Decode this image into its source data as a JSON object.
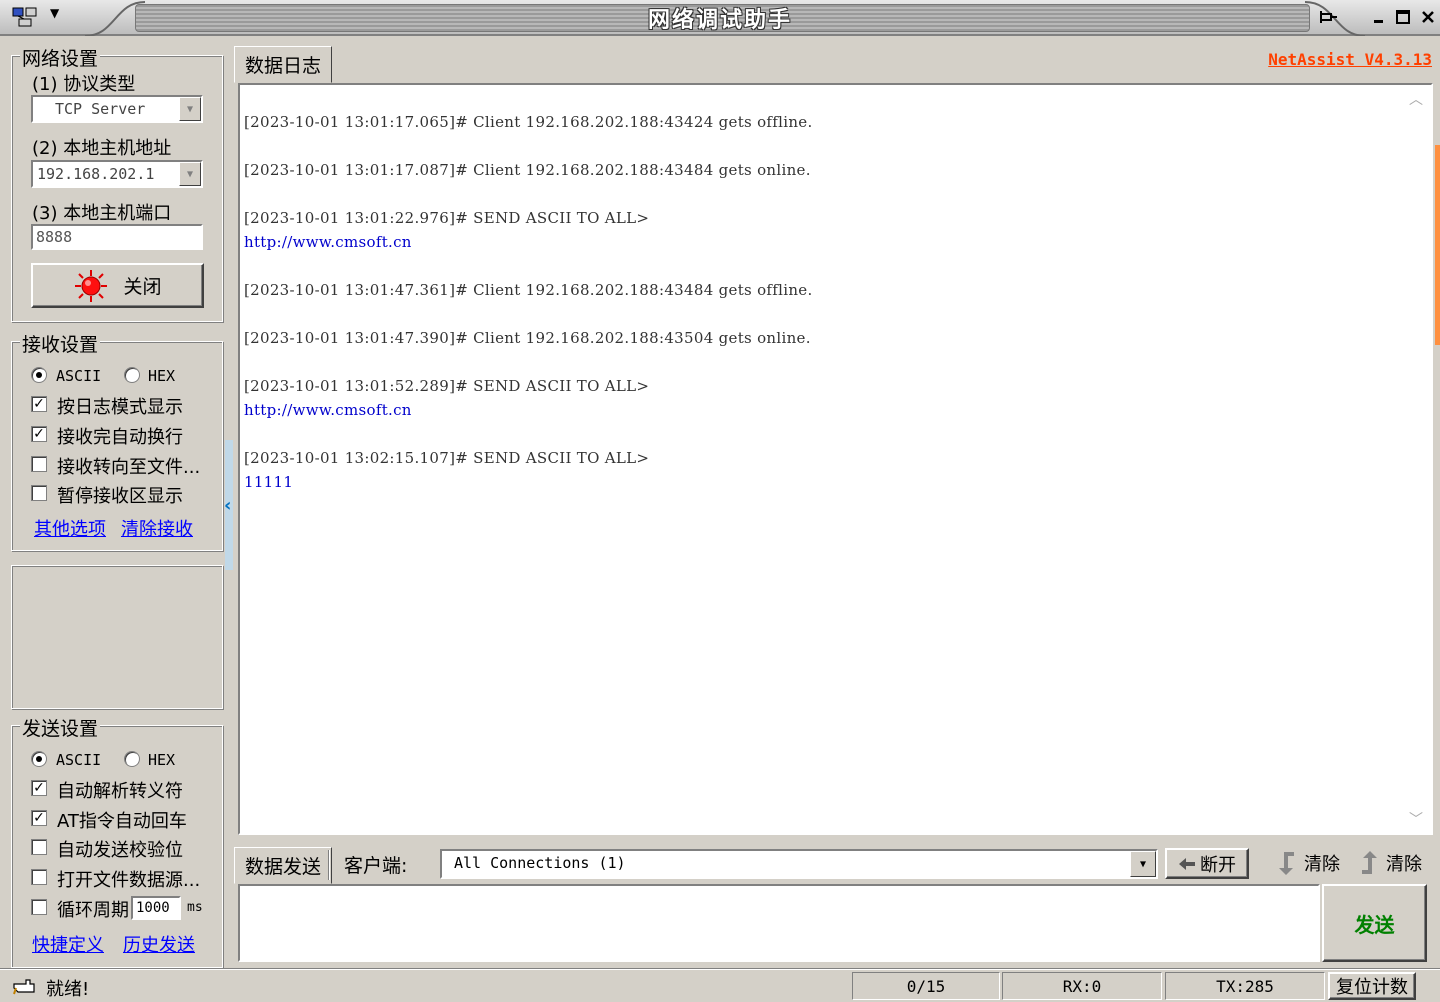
{
  "window": {
    "title": "网络调试助手",
    "brand": "NetAssist V4.3.13"
  },
  "network": {
    "group_title": "网络设置",
    "protocol_label": "(1) 协议类型",
    "protocol_value": "TCP Server",
    "host_label": "(2) 本地主机地址",
    "host_value": "192.168.202.1",
    "port_label": "(3) 本地主机端口",
    "port_value": "8888",
    "close_button": "关闭"
  },
  "receive": {
    "group_title": "接收设置",
    "ascii": "ASCII",
    "hex": "HEX",
    "options": [
      {
        "label": "按日志模式显示",
        "checked": true
      },
      {
        "label": "接收完自动换行",
        "checked": true
      },
      {
        "label": "接收转向至文件...",
        "checked": false
      },
      {
        "label": "暂停接收区显示",
        "checked": false
      }
    ],
    "link_more": "其他选项",
    "link_clear": "清除接收"
  },
  "send": {
    "group_title": "发送设置",
    "ascii": "ASCII",
    "hex": "HEX",
    "options": [
      {
        "label": "自动解析转义符",
        "checked": true
      },
      {
        "label": "AT指令自动回车",
        "checked": true
      },
      {
        "label": "自动发送校验位",
        "checked": false
      },
      {
        "label": "打开文件数据源...",
        "checked": false
      }
    ],
    "loop_label": "循环周期",
    "loop_value": "1000",
    "loop_unit": "ms",
    "link_shortcut": "快捷定义",
    "link_history": "历史发送"
  },
  "log": {
    "tab_label": "数据日志",
    "lines": [
      {
        "text": "[2023-10-01 13:01:17.065]# Client 192.168.202.188:43424 gets offline.",
        "data": false
      },
      {
        "text": "[2023-10-01 13:01:17.087]# Client 192.168.202.188:43484 gets online.",
        "data": false
      },
      {
        "text": "[2023-10-01 13:01:22.976]# SEND ASCII TO ALL>",
        "data": false
      },
      {
        "text": "http://www.cmsoft.cn",
        "data": true
      },
      {
        "text": "[2023-10-01 13:01:47.361]# Client 192.168.202.188:43484 gets offline.",
        "data": false
      },
      {
        "text": "[2023-10-01 13:01:47.390]# Client 192.168.202.188:43504 gets online.",
        "data": false
      },
      {
        "text": "[2023-10-01 13:01:52.289]# SEND ASCII TO ALL>",
        "data": false
      },
      {
        "text": "http://www.cmsoft.cn",
        "data": true
      },
      {
        "text": "[2023-10-01 13:02:15.107]# SEND ASCII TO ALL>",
        "data": false
      },
      {
        "text": "11111",
        "data": true
      }
    ]
  },
  "sendbar": {
    "tab_label": "数据发送",
    "client_label": "客户端:",
    "client_value": "All Connections (1)",
    "disconnect": "断开",
    "clear1": "清除",
    "clear2": "清除",
    "send_button": "发送"
  },
  "status": {
    "ready": "就绪!",
    "count": "0/15",
    "rx": "RX:0",
    "tx": "TX:285",
    "reset": "复位计数"
  }
}
